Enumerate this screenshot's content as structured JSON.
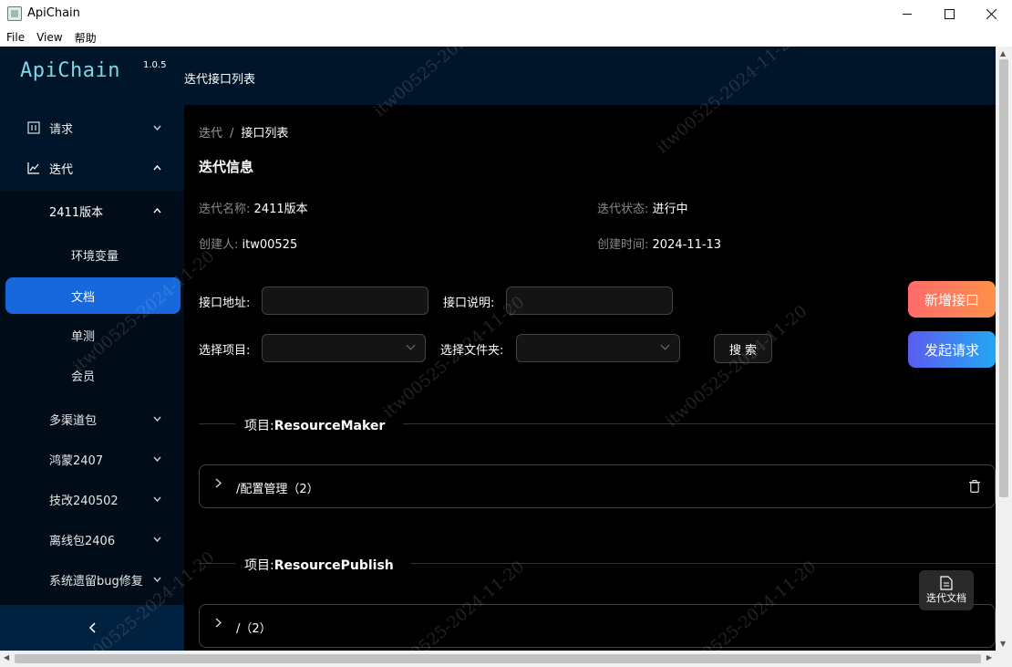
{
  "window": {
    "title": "ApiChain",
    "minimize": "—",
    "maximize": "☐",
    "close": "✕"
  },
  "menubar": {
    "items": [
      "File",
      "View",
      "帮助"
    ]
  },
  "sidebar": {
    "logo": "ApiChain",
    "version": "1.0.5",
    "items": [
      {
        "label": "请求",
        "icon": "request-icon",
        "chevron": "⌄"
      },
      {
        "label": "迭代",
        "icon": "iteration-icon",
        "chevron": "⌃"
      },
      {
        "label": "2411版本",
        "chevron": "⌃"
      },
      {
        "label": "环境变量"
      },
      {
        "label": "文档"
      },
      {
        "label": "单测"
      },
      {
        "label": "会员"
      },
      {
        "label": "多渠道包",
        "chevron": "⌄"
      },
      {
        "label": "鸿蒙2407",
        "chevron": "⌄"
      },
      {
        "label": "技改240502",
        "chevron": "⌄"
      },
      {
        "label": "离线包2406",
        "chevron": "⌄"
      },
      {
        "label": "系统遗留bug修复",
        "chevron": "⌄"
      }
    ],
    "collapse": "<"
  },
  "header": {
    "title": "迭代接口列表"
  },
  "breadcrumb": {
    "root": "迭代",
    "sep": "/",
    "current": "接口列表"
  },
  "info": {
    "section_title": "迭代信息",
    "name_key": "迭代名称:",
    "name_value": "2411版本",
    "status_key": "迭代状态:",
    "status_value": "进行中",
    "creator_key": "创建人:",
    "creator_value": "itw00525",
    "created_key": "创建时间:",
    "created_value": "2024-11-13"
  },
  "form": {
    "api_addr_label": "接口地址:",
    "api_desc_label": "接口说明:",
    "project_label": "选择项目:",
    "folder_label": "选择文件夹:",
    "search_button": "搜 索",
    "new_api_button": "新增接口",
    "send_request_button": "发起请求"
  },
  "projects": [
    {
      "label": "项目:",
      "name": "ResourceMaker",
      "folder": "/配置管理（2）"
    },
    {
      "label": "项目:",
      "name": "ResourcePublish",
      "folder": "/（2）"
    }
  ],
  "float_button": {
    "label": "迭代文档"
  },
  "watermark": "itw00525-2024-11-20",
  "colors": {
    "sidebar_bg": "#001529",
    "active_item": "#1668dc",
    "new_btn_start": "#ff6b6b",
    "send_btn_start": "#5b5cf0",
    "logo": "#7fd7e6"
  }
}
